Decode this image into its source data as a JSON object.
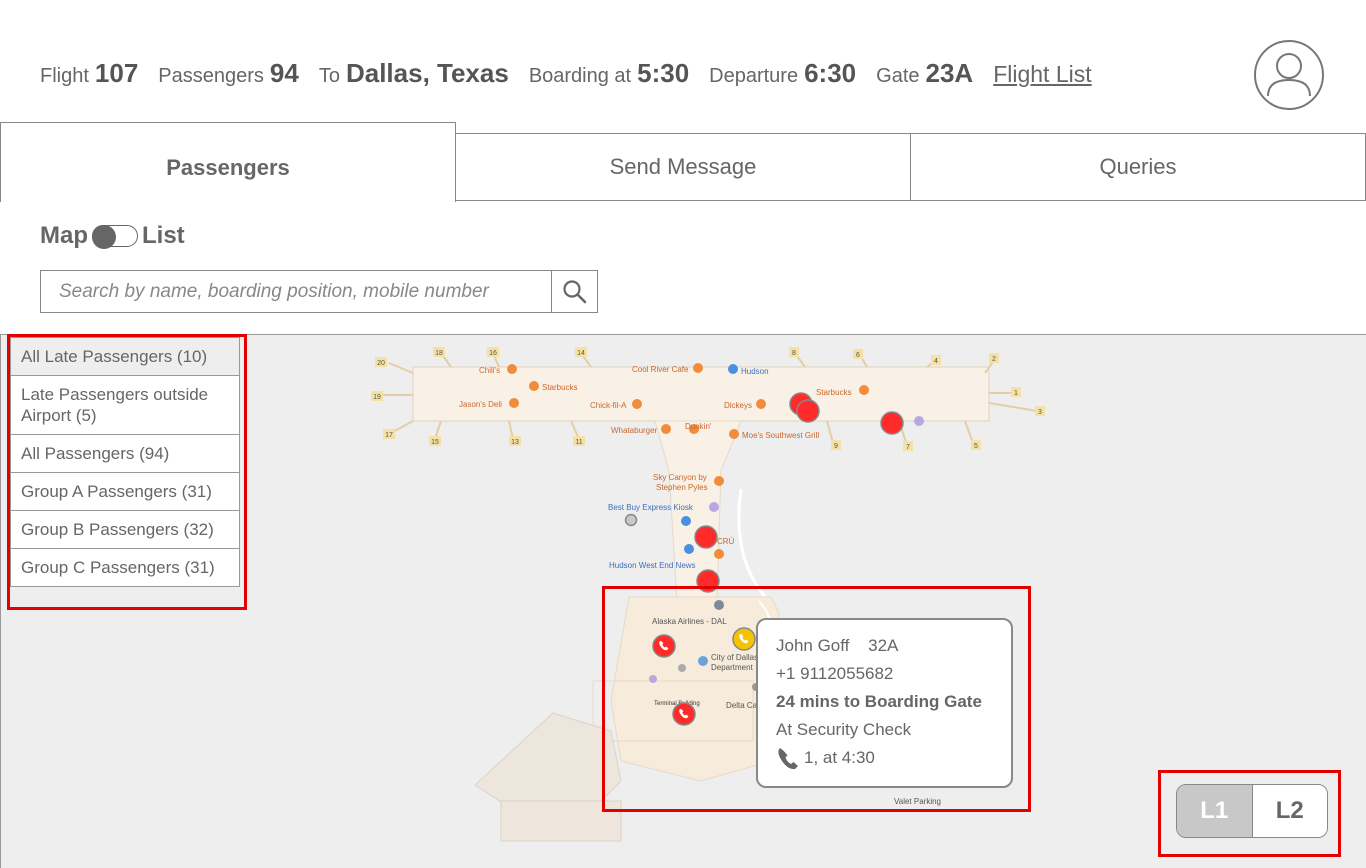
{
  "header": {
    "flight_label": "Flight",
    "flight_value": "107",
    "passengers_label": "Passengers",
    "passengers_value": "94",
    "to_label": "To",
    "to_value": "Dallas, Texas",
    "boarding_label": "Boarding at",
    "boarding_value": "5:30",
    "departure_label": "Departure",
    "departure_value": "6:30",
    "gate_label": "Gate",
    "gate_value": "23A",
    "flight_list_link": "Flight List",
    "avatar_icon": "user-icon"
  },
  "tabs": [
    {
      "label": "Passengers",
      "active": true
    },
    {
      "label": "Send Message",
      "active": false
    },
    {
      "label": "Queries",
      "active": false
    }
  ],
  "view_toggle": {
    "left": "Map",
    "right": "List",
    "selected": "Map"
  },
  "search": {
    "placeholder": "Search by name, boarding position, mobile number",
    "value": "",
    "icon": "search-icon"
  },
  "filters": [
    {
      "label": "All Late Passengers (10)",
      "active": true
    },
    {
      "label": "Late Passengers outside Airport (5)",
      "active": false
    },
    {
      "label": "All Passengers (94)",
      "active": false
    },
    {
      "label": "Group A Passengers (31)",
      "active": false
    },
    {
      "label": "Group B Passengers (32)",
      "active": false
    },
    {
      "label": "Group C Passengers (31)",
      "active": false
    }
  ],
  "map": {
    "places": {
      "cool_river": "Cool River Cafe",
      "hudson": "Hudson",
      "chilis": "Chili's",
      "starbucks_1": "Starbucks",
      "starbucks_2": "Starbucks",
      "jasons_deli": "Jason's Deli",
      "chick_fil_a": "Chick-fil-A",
      "dickeys": "Dickeys",
      "whataburger": "Whataburger",
      "dunkin": "Dunkin'",
      "moes": "Moe's Southwest Grill",
      "sky_canyon_1": "Sky Canyon by",
      "sky_canyon_2": "Stephen Pyles",
      "best_buy": "Best Buy Express Kiosk",
      "cru": "CRÙ",
      "hudson_west": "Hudson West End News",
      "alaska": "Alaska Airlines - DAL",
      "city_dallas_1": "City of Dallas",
      "city_dallas_2": "Department",
      "terminal": "Terminal Building",
      "delta": "Delta Ca",
      "valet": "Valet Parking"
    },
    "gates": [
      "20",
      "18",
      "16",
      "14",
      "8",
      "6",
      "4",
      "2",
      "19",
      "1",
      "3",
      "17",
      "15",
      "13",
      "11",
      "9",
      "7",
      "5"
    ],
    "colors": {
      "late": "#ff2a2a",
      "warning": "#f5c400",
      "neutral": "#c8c8c8"
    }
  },
  "popup": {
    "name": "John Goff",
    "seat": "32A",
    "phone": "+1 9112055682",
    "status": "24 mins to Boarding Gate",
    "location": "At Security Check",
    "call_info": "1, at 4:30",
    "call_icon": "phone-icon"
  },
  "levels": [
    {
      "label": "L1",
      "active": true
    },
    {
      "label": "L2",
      "active": false
    }
  ]
}
